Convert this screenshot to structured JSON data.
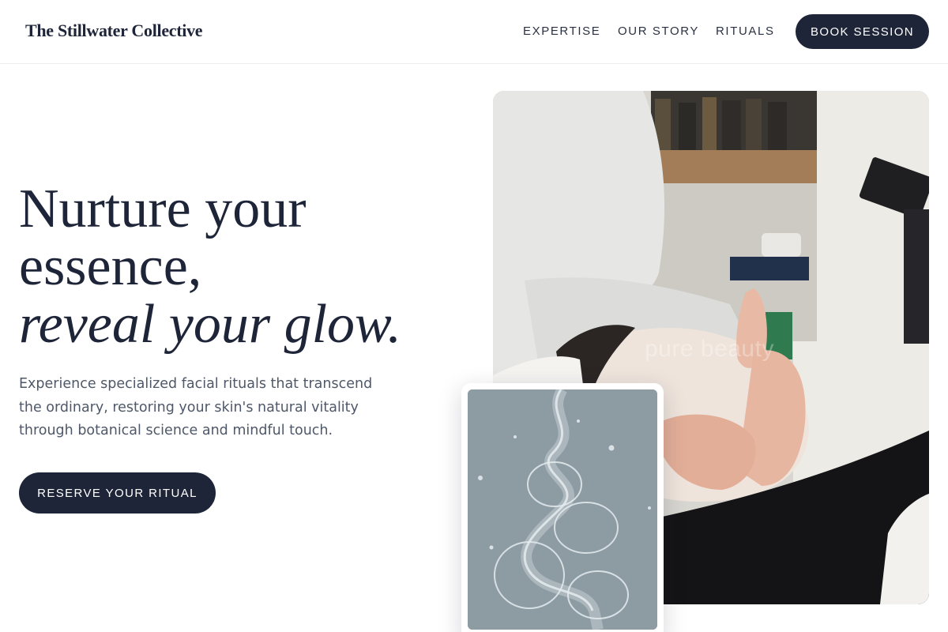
{
  "header": {
    "brand": "The Stillwater Collective",
    "nav": [
      "EXPERTISE",
      "OUR STORY",
      "RITUALS"
    ],
    "cta_label": "BOOK SESSION"
  },
  "hero": {
    "headline_line1": "Nurture your",
    "headline_line2": "essence,",
    "headline_line3": "reveal your glow.",
    "description": "Experience specialized facial rituals that transcend the ordinary, restoring your skin's natural vitality through botanical science and mindful touch.",
    "cta_label": "RESERVE YOUR RITUAL"
  },
  "images": {
    "main_watermark": "pure beauty"
  },
  "colors": {
    "primary": "#1e2538",
    "body_text": "#4e5869",
    "background": "#ffffff",
    "inset_bg": "#8d9ba3"
  }
}
